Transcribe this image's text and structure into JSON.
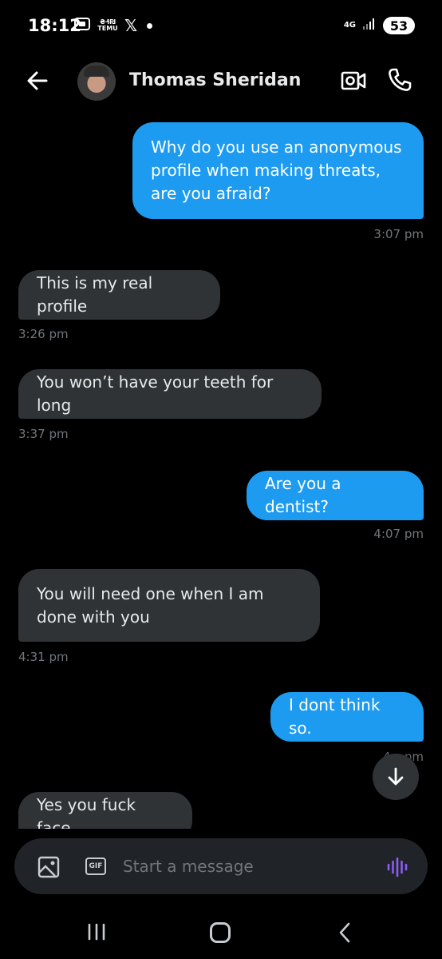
{
  "status_bar": {
    "time": "18:12",
    "temu_label": "₴₰₪₿\nTEMU",
    "x_label": "𝕏",
    "network": "4G",
    "battery": "53"
  },
  "header": {
    "contact_name": "Thomas Sheridan"
  },
  "messages": [
    {
      "direction": "out",
      "text": "Why do you use an anonymous profile when making threats, are you afraid?",
      "time": "3:07 pm"
    },
    {
      "direction": "in",
      "text": "This is my real profile",
      "time": "3:26 pm"
    },
    {
      "direction": "in",
      "text": "You won’t have your teeth for long",
      "time": "3:37 pm"
    },
    {
      "direction": "out",
      "text": "Are you a dentist?",
      "time": "4:07 pm"
    },
    {
      "direction": "in",
      "text": "You will need one when I am done with you",
      "time": "4:31 pm"
    },
    {
      "direction": "out",
      "text": "I dont think so.",
      "time": "4:_ pm"
    },
    {
      "direction": "in",
      "text": "Yes you fuck face",
      "time": ""
    }
  ],
  "composer": {
    "placeholder": "Start a message",
    "gif_label": "GIF"
  },
  "colors": {
    "outgoing_bubble": "#1d9bf0",
    "incoming_bubble": "#2f3336",
    "voice_accent": "#8b5cf6"
  },
  "icons": [
    "back-arrow-icon",
    "video-call-icon",
    "phone-icon",
    "scroll-down-arrow-icon",
    "image-icon",
    "gif-icon",
    "voice-waveform-icon"
  ]
}
